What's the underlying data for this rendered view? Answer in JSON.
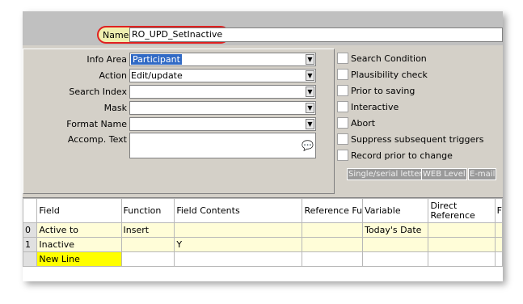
{
  "name": {
    "label": "Name",
    "value": "RO_UPD_SetInactive"
  },
  "form": {
    "info_area": {
      "label": "Info Area",
      "value": "Participant"
    },
    "action": {
      "label": "Action",
      "value": "Edit/update"
    },
    "search_index": {
      "label": "Search Index",
      "value": ""
    },
    "mask": {
      "label": "Mask",
      "value": ""
    },
    "format_name": {
      "label": "Format Name",
      "value": ""
    },
    "accomp_text": {
      "label": "Accomp. Text",
      "value": ""
    }
  },
  "checks": [
    {
      "label": "Search Condition"
    },
    {
      "label": "Plausibility check"
    },
    {
      "label": "Prior to saving"
    },
    {
      "label": "Interactive"
    },
    {
      "label": "Abort"
    },
    {
      "label": "Suppress subsequent triggers"
    },
    {
      "label": "Record prior to change"
    }
  ],
  "buttons": {
    "single_serial": "Single/serial letter",
    "web_level": "WEB Level",
    "email": "E-mail"
  },
  "grid": {
    "headers": [
      "",
      "Field",
      "Function",
      "Field Contents",
      "Reference Fu",
      "Variable",
      "Direct Reference",
      "F"
    ],
    "rows": [
      [
        "0",
        "Active to",
        "Insert",
        "",
        "",
        "Today's Date",
        "",
        ""
      ],
      [
        "1",
        "Inactive",
        "",
        "Y",
        "",
        "",
        "",
        ""
      ]
    ],
    "new_line": "New Line"
  },
  "colors": {
    "name_highlight_border": "#e02020",
    "row_bg": "#fffdd8",
    "new_line_bg": "#ffff00",
    "selection": "#316ac5"
  }
}
